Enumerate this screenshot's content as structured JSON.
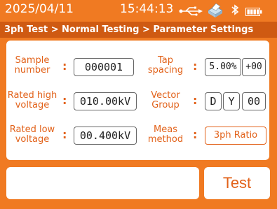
{
  "status": {
    "date": "2025/04/11",
    "time": "15:44:13"
  },
  "breadcrumb": "3ph Test > Normal Testing > Parameter Settings",
  "fields": {
    "sample_number": {
      "label": "Sample number",
      "value": "000001"
    },
    "rated_high_voltage": {
      "label": "Rated high voltage",
      "value": "010.00kV"
    },
    "rated_low_voltage": {
      "label": "Rated low voltage",
      "value": "00.400kV"
    },
    "tap_spacing": {
      "label": "Tap spacing",
      "value": "5.00%",
      "offset": "+00"
    },
    "vector_group": {
      "label": "Vector Group",
      "hv": "D",
      "lv": "Y",
      "clock": "00"
    },
    "meas_method": {
      "label": "Meas method",
      "value": "3ph Ratio"
    }
  },
  "colon": ":",
  "test_button": "Test",
  "colors": {
    "accent": "#f07a22",
    "crumb": "#cf5a12",
    "label": "#e2621a"
  },
  "icons": [
    "usb-icon",
    "printer-icon",
    "bluetooth-icon",
    "battery-icon"
  ]
}
